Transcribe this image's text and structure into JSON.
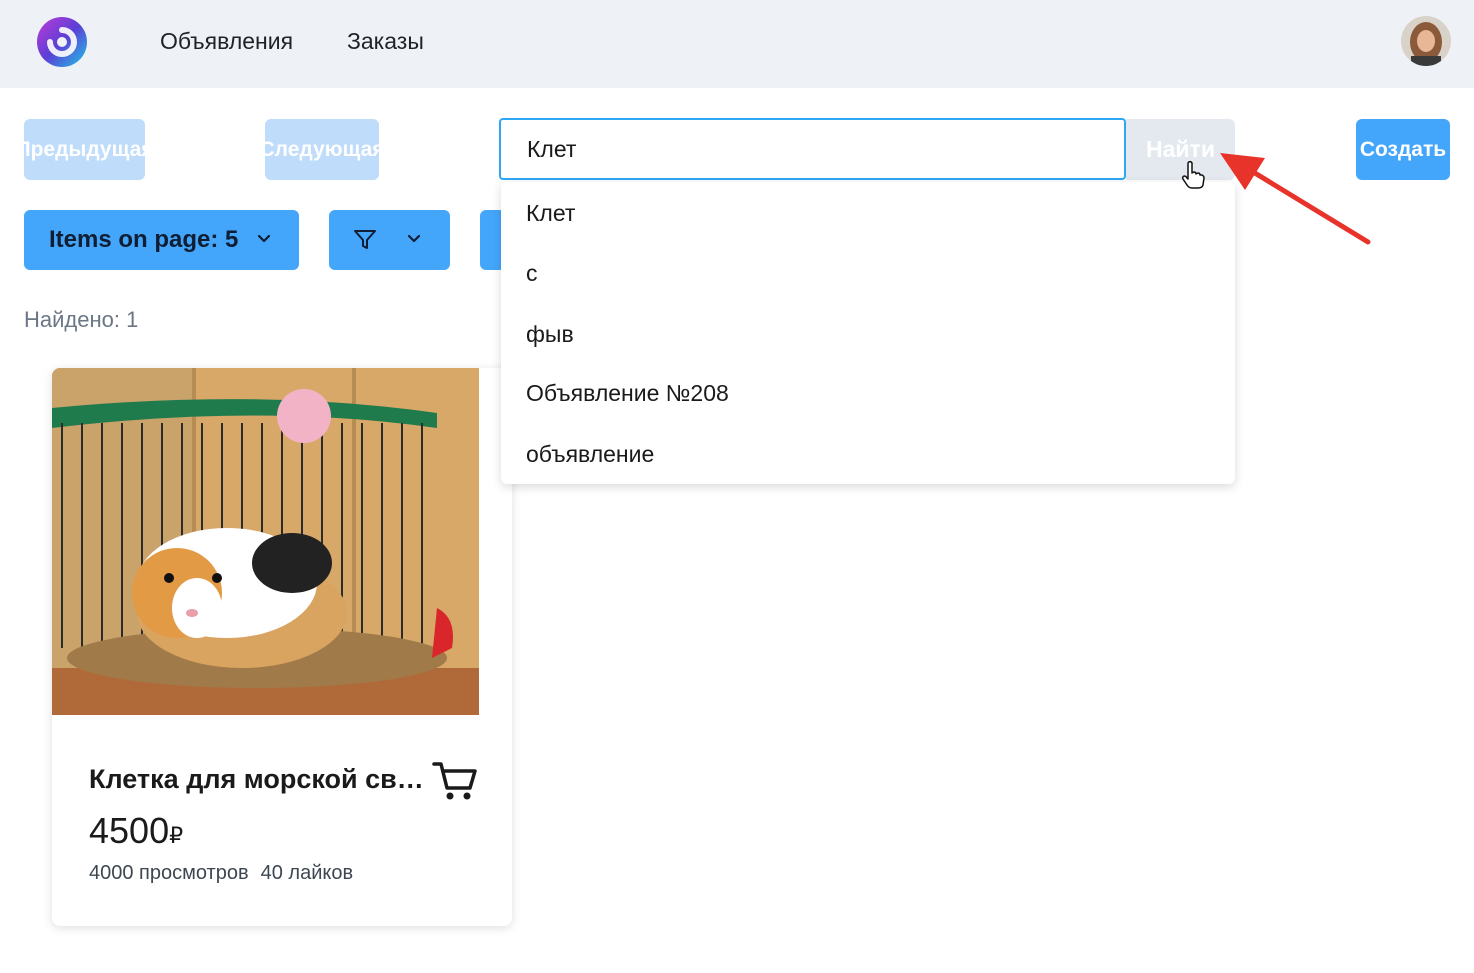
{
  "nav": {
    "ads_label": "Объявления",
    "orders_label": "Заказы"
  },
  "toolbar": {
    "prev_label": "Предыдущая",
    "next_label": "Следующая",
    "search_value": "Клет",
    "find_label": "Найти",
    "create_label": "Создать",
    "items_on_page_label": "Items on page: 5"
  },
  "results": {
    "found_label": "Найдено: 1"
  },
  "suggestions": [
    "Клет",
    "с",
    "фыв",
    "Объявление №208",
    "объявление"
  ],
  "card": {
    "title": "Клетка для морской свинки",
    "price": "4500",
    "currency": "₽",
    "views": "4000 просмотров",
    "likes": "40 лайков"
  },
  "colors": {
    "accent": "#44a6fb",
    "accent_disabled": "#bfdcfb",
    "input_focus": "#2ea8f5",
    "annotation_arrow": "#e8332a"
  }
}
